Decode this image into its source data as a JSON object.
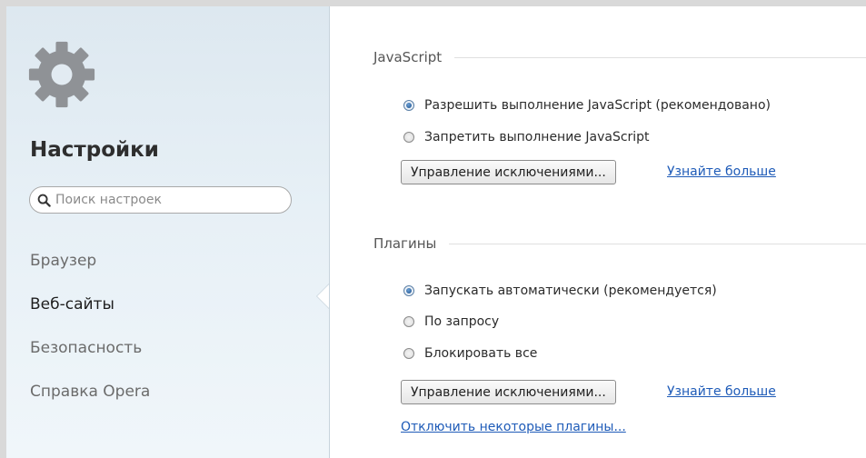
{
  "sidebar": {
    "title": "Настройки",
    "search_placeholder": "Поиск настроек",
    "items": [
      {
        "label": "Браузер",
        "active": false
      },
      {
        "label": "Веб-сайты",
        "active": true
      },
      {
        "label": "Безопасность",
        "active": false
      },
      {
        "label": "Справка Opera",
        "active": false
      }
    ]
  },
  "javascript": {
    "header": "JavaScript",
    "options": [
      {
        "label": "Разрешить выполнение JavaScript (рекомендовано)",
        "checked": true
      },
      {
        "label": "Запретить выполнение JavaScript",
        "checked": false
      }
    ],
    "manage_button": "Управление исключениями...",
    "learn_more": "Узнайте больше"
  },
  "plugins": {
    "header": "Плагины",
    "options": [
      {
        "label": "Запускать автоматически (рекомендуется)",
        "checked": true
      },
      {
        "label": "По запросу",
        "checked": false
      },
      {
        "label": "Блокировать все",
        "checked": false
      }
    ],
    "manage_button": "Управление исключениями...",
    "learn_more": "Узнайте больше",
    "disable_link": "Отключить некоторые плагины..."
  },
  "colors": {
    "link": "#1e5bb8",
    "radio_checked": "#1d4f8a",
    "sidebar_bg": "#e7f0f6"
  },
  "icons": {
    "settings": "gear-icon",
    "search": "search-icon"
  }
}
